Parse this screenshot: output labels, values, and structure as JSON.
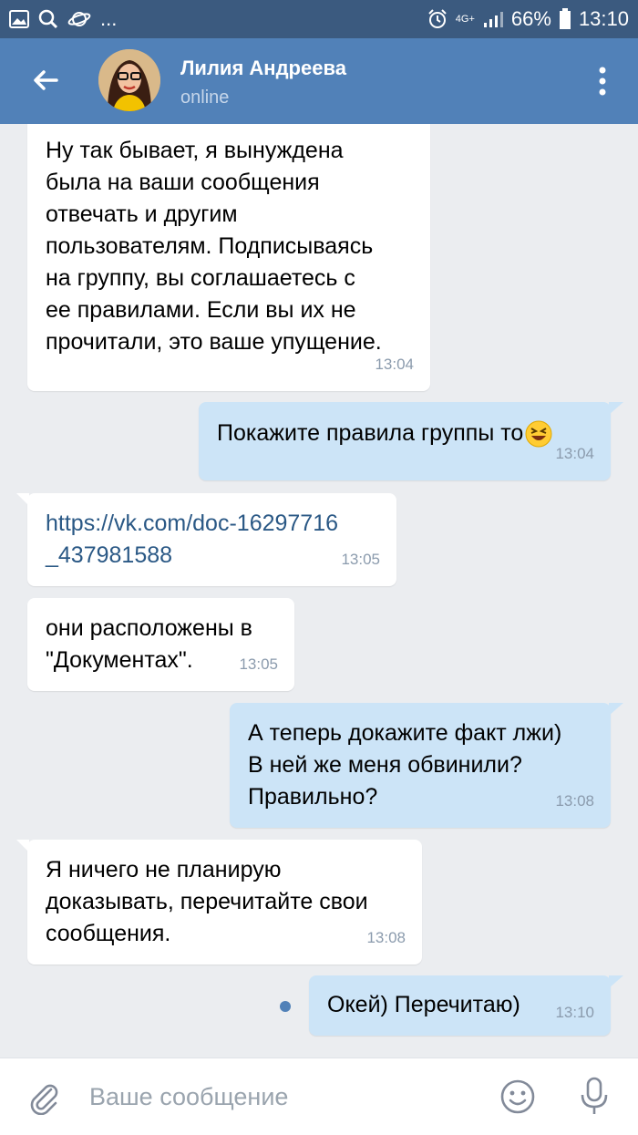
{
  "status_bar": {
    "network": "4G+",
    "battery": "66%",
    "time": "13:10"
  },
  "header": {
    "contact_name": "Лилия Андреева",
    "contact_status": "online"
  },
  "messages": [
    {
      "direction": "in",
      "text": "Ну так бывает, я вынуждена\nбыла на ваши сообщения\nотвечать и другим\nпользователям. Подписываясь\nна группу, вы соглашаетесь с\nее правилами. Если вы их не\nпрочитали, это ваше упущение.",
      "time": "13:04"
    },
    {
      "direction": "out",
      "text": "Покажите правила группы то",
      "emoji": "grinning-squinting-face-emoji",
      "time": "13:04"
    },
    {
      "direction": "in",
      "text": "https://vk.com/doc-16297716\n_437981588",
      "time": "13:05",
      "is_link": true
    },
    {
      "direction": "in",
      "text": "они расположены в\n\"Документах\".",
      "time": "13:05"
    },
    {
      "direction": "out",
      "text": "А теперь докажите факт лжи)\nВ ней же меня обвинили?\nПравильно?",
      "time": "13:08"
    },
    {
      "direction": "in",
      "text": "Я ничего не планирую\nдоказывать, перечитайте свои\nсообщения.",
      "time": "13:08"
    },
    {
      "direction": "out",
      "text": "Окей) Перечитаю)",
      "time": "13:10",
      "unread": true
    }
  ],
  "input": {
    "placeholder": "Ваше сообщение"
  },
  "colors": {
    "status_bar": "#3b5a7f",
    "header": "#5181b8",
    "background": "#ebedf0",
    "incoming_bubble": "#ffffff",
    "outgoing_bubble": "#cce4f7",
    "link": "#2a5885"
  },
  "icons": [
    "gallery-icon",
    "search-icon",
    "planet-icon",
    "alarm-icon",
    "signal-icon",
    "battery-icon",
    "back-arrow-icon",
    "more-vert-icon",
    "attach-icon",
    "emoji-icon",
    "mic-icon"
  ]
}
